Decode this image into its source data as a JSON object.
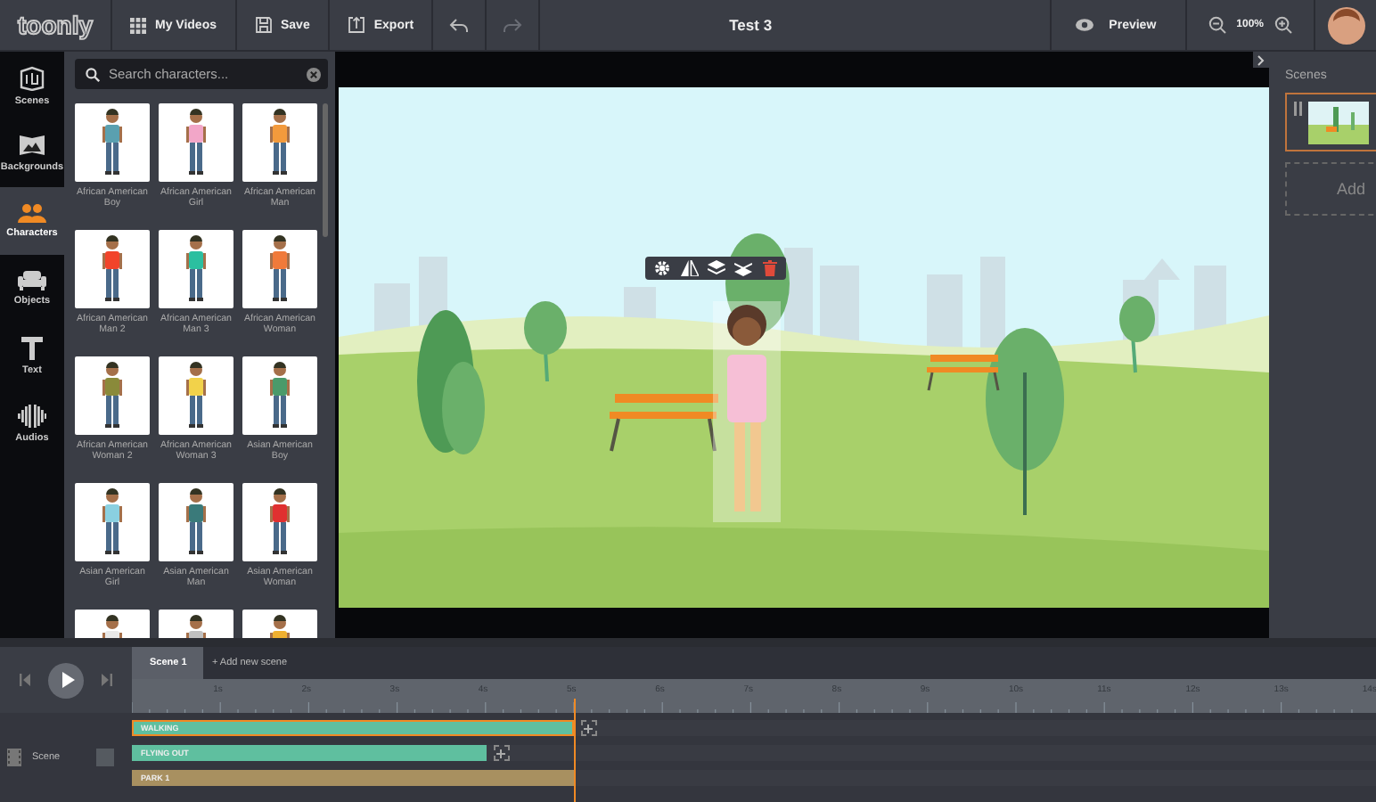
{
  "top_bar": {
    "logo": "toonly",
    "buttons": [
      {
        "kind": "grid",
        "label": "My Videos"
      },
      {
        "kind": "save",
        "label": "Save"
      },
      {
        "kind": "export",
        "label": "Export"
      }
    ],
    "undo": {
      "disabled": false
    },
    "redo": {
      "disabled": true
    },
    "title": "Test 3",
    "preview": "Preview",
    "zoom": "100%"
  },
  "sidebar": {
    "items": [
      {
        "kind": "scenes",
        "label": "Scenes",
        "selected": false
      },
      {
        "kind": "backgrounds",
        "label": "Backgrounds",
        "selected": false
      },
      {
        "kind": "characters",
        "label": "Characters",
        "selected": true
      },
      {
        "kind": "objects",
        "label": "Objects",
        "selected": false
      },
      {
        "kind": "text",
        "label": "Text",
        "selected": false
      },
      {
        "kind": "audios",
        "label": "Audios",
        "selected": false
      }
    ]
  },
  "library": {
    "search": {
      "placeholder": "Search characters..."
    },
    "items": [
      {
        "name": "African American Boy",
        "color": "#5aa0b0"
      },
      {
        "name": "African American Girl",
        "color": "#f2a6c8"
      },
      {
        "name": "African American Man",
        "color": "#f39a3c"
      },
      {
        "name": "African American Man 2",
        "color": "#f2442a"
      },
      {
        "name": "African American Man 3",
        "color": "#2bbfa0"
      },
      {
        "name": "African American Woman",
        "color": "#f07a3a"
      },
      {
        "name": "African American Woman 2",
        "color": "#8a8a3a"
      },
      {
        "name": "African American Woman 3",
        "color": "#f2d24a"
      },
      {
        "name": "Asian American Boy",
        "color": "#4a9a6a"
      },
      {
        "name": "Asian American Girl",
        "color": "#8ad0e0"
      },
      {
        "name": "Asian American Man",
        "color": "#3a7a7a"
      },
      {
        "name": "Asian American Woman",
        "color": "#e03030"
      },
      {
        "color": "#e8e8e8"
      },
      {
        "color": "#c0c0c0"
      },
      {
        "color": "#f0b030"
      }
    ]
  },
  "stage": {
    "toolbar": [
      {
        "kind": "settings"
      },
      {
        "kind": "flip"
      },
      {
        "kind": "layer-up"
      },
      {
        "kind": "layer-down"
      },
      {
        "kind": "delete"
      }
    ]
  },
  "scenes_panel": {
    "title": "Scenes",
    "scenes": [
      {
        "selected": true
      }
    ],
    "add_label": "Add"
  },
  "timeline": {
    "tabs": [
      {
        "label": "Scene 1",
        "selected": true
      }
    ],
    "add_scene": "+ Add new scene",
    "ticks": [
      "1s",
      "2s",
      "3s",
      "4s",
      "5s",
      "6s",
      "7s",
      "8s",
      "9s",
      "10s",
      "11s",
      "12s",
      "13s",
      "14s"
    ],
    "playhead": {
      "level": 0.355
    },
    "track": {
      "label": "Scene"
    },
    "clips": [
      {
        "kind": "action",
        "label": "WALKING",
        "color": "#5fbf9f",
        "level": 0.355,
        "selected": true
      },
      {
        "kind": "action",
        "label": "FLYING OUT",
        "color": "#5fbf9f",
        "level": 0.285,
        "selected": false
      },
      {
        "kind": "background",
        "label": "PARK 1",
        "color": "#a89060",
        "level": 0.355,
        "selected": false
      }
    ]
  }
}
